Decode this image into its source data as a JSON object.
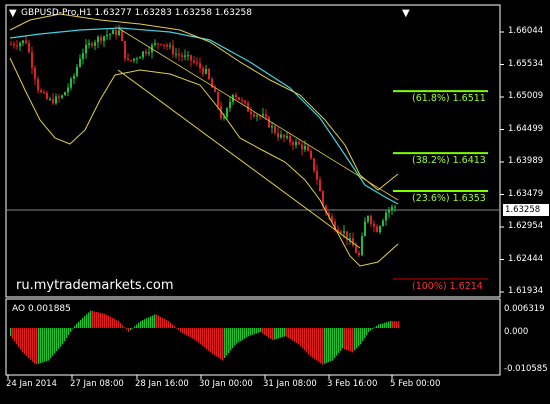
{
  "header": {
    "symbol_line": "GBPUSD-Pro,H1  1.63277 1.63283 1.63258 1.63258"
  },
  "watermark": "ru.mytrademarkets.com",
  "current_price": "1.63258",
  "price_axis": [
    "1.66044",
    "1.65534",
    "1.65009",
    "1.64499",
    "1.63989",
    "1.63479",
    "1.62954",
    "1.62444",
    "1.61934"
  ],
  "date_axis": [
    "24 Jan 2014",
    "27 Jan 08:00",
    "28 Jan 16:00",
    "30 Jan 00:00",
    "31 Jan 08:00",
    "3 Feb 16:00",
    "5 Feb 00:00"
  ],
  "fib_levels": [
    {
      "label": "(61.8%) 1.6511",
      "color": "#9dff3c",
      "line": "#7cff00",
      "price": 1.6511
    },
    {
      "label": "(38.2%) 1.6413",
      "color": "#9dff3c",
      "line": "#7cff00",
      "price": 1.6413
    },
    {
      "label": "(23.6%) 1.6353",
      "color": "#9dff3c",
      "line": "#7cff00",
      "price": 1.6353
    },
    {
      "label": "(100%) 1.6214",
      "color": "#ff3030",
      "line": "#d00000",
      "price": 1.6214
    }
  ],
  "indicator": {
    "label": "AO 0.001885",
    "axis": [
      "0.006319",
      "0.000",
      "-0.010585"
    ]
  },
  "colors": {
    "up_bar": "#1dbf3a",
    "down_bar": "#e02020",
    "ma_line": "#40d0e0",
    "band_line": "#e0d040",
    "grid": "#ffffff"
  },
  "chart_data": {
    "type": "candlestick",
    "title": "GBPUSD-Pro,H1",
    "ylim": [
      1.6189,
      1.6634
    ],
    "x_ticks": [
      "24 Jan 2014",
      "27 Jan 08:00",
      "28 Jan 16:00",
      "30 Jan 00:00",
      "31 Jan 08:00",
      "3 Feb 16:00",
      "5 Feb 00:00"
    ],
    "last": 1.63258,
    "fib_levels": [
      1.6511,
      1.6413,
      1.6353,
      1.6214
    ],
    "ao_range": [
      -0.010585,
      0.006319
    ],
    "ao_last": 0.001885
  }
}
